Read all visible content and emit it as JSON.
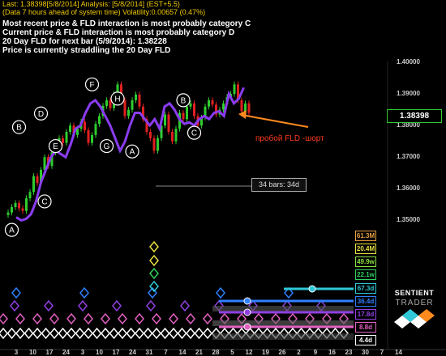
{
  "header": {
    "line1": "Last: 1.38398[5/8/2014] Analysis: [5/8/2014] (EST+5.5)",
    "line2": "(Data 7 hours ahead of system time) Volatility:0.00657 (0.47%)",
    "lines": [
      "Most recent price & FLD interaction is most probably category C",
      "Current price & FLD interaction is most probably category D",
      "20 Day FLD for next bar (5/9/2014): 1.38228",
      "Price is currently straddling the 20 Day FLD"
    ]
  },
  "last_price": "1.38398",
  "annotation": "пробой FLD -шорт",
  "bars_label": "34 bars: 34d",
  "brand": {
    "line1": "SENTIENT",
    "line2": "TRADER"
  },
  "cycle_labels": [
    {
      "text": "61.3M",
      "color": "#e8a040"
    },
    {
      "text": "20.4M",
      "color": "#e8e040"
    },
    {
      "text": "49.9w",
      "color": "#8ce040"
    },
    {
      "text": "22.1w",
      "color": "#30d060"
    },
    {
      "text": "67.3d",
      "color": "#30c8d8"
    },
    {
      "text": "36.4d",
      "color": "#3080ff"
    },
    {
      "text": "17.8d",
      "color": "#9040e0"
    },
    {
      "text": "8.8d",
      "color": "#e060c0"
    },
    {
      "text": "4.4d",
      "color": "#ffffff"
    }
  ],
  "chart_data": {
    "type": "candlestick",
    "y_ticks": [
      "1.40000",
      "1.39000",
      "1.38000",
      "1.37000",
      "1.36000",
      "1.35000"
    ],
    "ylim": [
      1.3455,
      1.4005
    ],
    "x_ticks": [
      "3",
      "10",
      "17",
      "24",
      "3",
      "10",
      "17",
      "24",
      "31",
      "7",
      "14",
      "21",
      "28",
      "5",
      "12",
      "19",
      "26",
      "2",
      "9",
      "16",
      "23",
      "30",
      "7",
      "14"
    ],
    "closes": [
      1.3525,
      1.3542,
      1.3555,
      1.3538,
      1.353,
      1.357,
      1.359,
      1.364,
      1.3618,
      1.366,
      1.37,
      1.3672,
      1.3715,
      1.373,
      1.376,
      1.3745,
      1.378,
      1.38,
      1.377,
      1.379,
      1.3812,
      1.3785,
      1.3745,
      1.377,
      1.3805,
      1.383,
      1.3862,
      1.388,
      1.3855,
      1.39,
      1.393,
      1.388,
      1.383,
      1.385,
      1.388,
      1.3898,
      1.386,
      1.382,
      1.378,
      1.376,
      1.372,
      1.376,
      1.38,
      1.3835,
      1.378,
      1.375,
      1.379,
      1.384,
      1.382,
      1.386,
      1.387,
      1.383,
      1.38,
      1.3825,
      1.386,
      1.388,
      1.3866,
      1.3835,
      1.385,
      1.387,
      1.389,
      1.39,
      1.393,
      1.388,
      1.3845,
      1.387,
      1.384
    ],
    "fld": [
      1.351,
      1.35,
      1.3505,
      1.352,
      1.356,
      1.362,
      1.366,
      1.37,
      1.372,
      1.371,
      1.37,
      1.374,
      1.379,
      1.38,
      1.384,
      1.387,
      1.388,
      1.386,
      1.383,
      1.38,
      1.376,
      1.372,
      1.375,
      1.38,
      1.384,
      1.384,
      1.382,
      1.38,
      1.382,
      1.379,
      1.386,
      1.387,
      1.385,
      1.382,
      1.3805,
      1.381,
      1.38,
      1.382,
      1.383,
      1.382,
      1.384,
      1.3845,
      1.383,
      1.39,
      1.387,
      1.3885,
      1.392
    ],
    "peak_trough_labels": [
      {
        "label": "A",
        "bar": 1,
        "price": 1.347
      },
      {
        "label": "C",
        "bar": 10,
        "price": 1.356
      },
      {
        "label": "B",
        "bar": 3,
        "price": 1.3795
      },
      {
        "label": "D",
        "bar": 9,
        "price": 1.3838
      },
      {
        "label": "E",
        "bar": 13,
        "price": 1.3735
      },
      {
        "label": "F",
        "bar": 23,
        "price": 1.393
      },
      {
        "label": "G",
        "bar": 27,
        "price": 1.3735
      },
      {
        "label": "H",
        "bar": 30,
        "price": 1.3885
      },
      {
        "label": "A",
        "bar": 34,
        "price": 1.3718
      },
      {
        "label": "B",
        "bar": 48,
        "price": 1.388
      },
      {
        "label": "C",
        "bar": 51,
        "price": 1.3777
      }
    ],
    "xlabel": "",
    "ylabel": "",
    "grid": false
  }
}
